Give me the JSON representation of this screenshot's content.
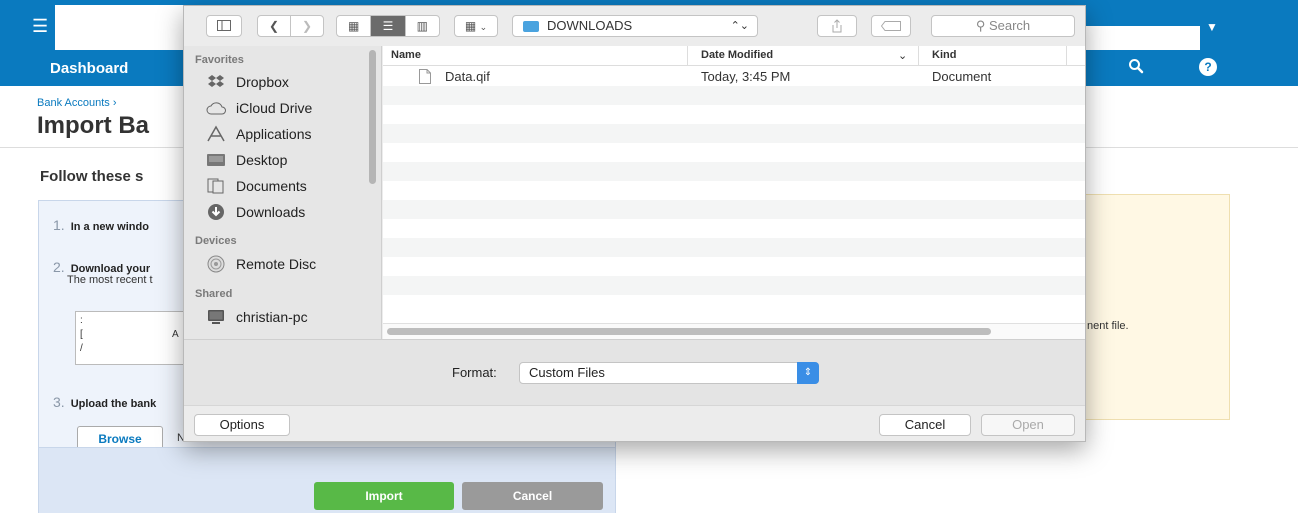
{
  "app": {
    "dashboard_label": "Dashboard",
    "breadcrumb": "Bank Accounts ›",
    "page_title": "Import Ba",
    "instructions_title": "Follow these s",
    "steps": [
      {
        "num": "1.",
        "text": "In a new windo"
      },
      {
        "num": "2.",
        "text": "Download your",
        "sub": "The most recent t"
      },
      {
        "num": "3.",
        "text": "Upload the bank"
      }
    ],
    "snippet_lines": [
      ":",
      "[",
      "/"
    ],
    "snippet_extra": "A",
    "browse_label": "Browse",
    "browse_note": "N",
    "import_label": "Import",
    "cancel_label": "Cancel",
    "info_text": "nent file."
  },
  "dialog": {
    "location": "DOWNLOADS",
    "search_placeholder": "Search",
    "sidebar": {
      "favorites_header": "Favorites",
      "favorites": [
        {
          "label": "Dropbox",
          "icon": "dropbox-icon"
        },
        {
          "label": "iCloud Drive",
          "icon": "cloud-icon"
        },
        {
          "label": "Applications",
          "icon": "applications-icon"
        },
        {
          "label": "Desktop",
          "icon": "desktop-icon"
        },
        {
          "label": "Documents",
          "icon": "documents-icon"
        },
        {
          "label": "Downloads",
          "icon": "downloads-icon"
        }
      ],
      "devices_header": "Devices",
      "devices": [
        {
          "label": "Remote Disc",
          "icon": "disc-icon"
        }
      ],
      "shared_header": "Shared",
      "shared": [
        {
          "label": "christian-pc",
          "icon": "computer-icon"
        }
      ]
    },
    "columns": {
      "name": "Name",
      "date": "Date Modified",
      "kind": "Kind"
    },
    "files": [
      {
        "name": "Data.qif",
        "date": "Today, 3:45 PM",
        "kind": "Document"
      }
    ],
    "format_label": "Format:",
    "format_value": "Custom Files",
    "options_label": "Options",
    "cancel_label": "Cancel",
    "open_label": "Open"
  }
}
